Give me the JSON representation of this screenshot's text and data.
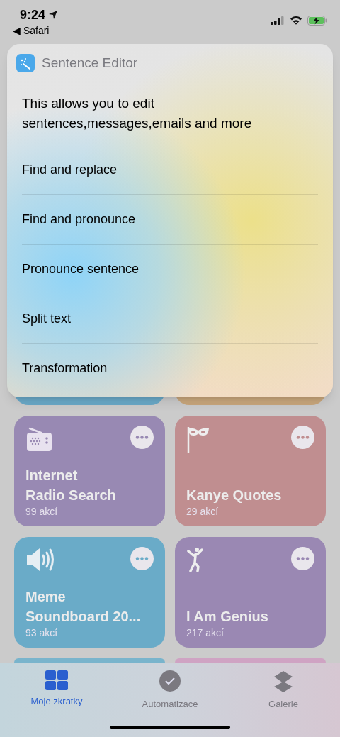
{
  "status_bar": {
    "time": "9:24",
    "back_link": "◀ Safari"
  },
  "shortcut_popup": {
    "app_name": "Sentence Editor",
    "description": "This allows you to edit sentences,messages,emails and more",
    "actions": [
      {
        "label": "Find and replace"
      },
      {
        "label": "Find and pronounce"
      },
      {
        "label": "Pronounce sentence"
      },
      {
        "label": "Split text"
      },
      {
        "label": "Transformation"
      }
    ]
  },
  "shortcuts": [
    {
      "kind": "partial",
      "color": "#6aa9c8"
    },
    {
      "kind": "partial",
      "color": "#c9a77c"
    },
    {
      "kind": "full",
      "title": "Internet\nRadio Search",
      "count": "99 akcí",
      "color": "#9889b3"
    },
    {
      "kind": "full",
      "title": "Kanye Quotes",
      "count": "29 akcí",
      "color": "#c08e90"
    },
    {
      "kind": "full",
      "title": "Meme\nSoundboard 20...",
      "count": "93 akcí",
      "color": "#6aabc8"
    },
    {
      "kind": "full",
      "title": "I Am Genius",
      "count": "217 akcí",
      "color": "#9a88b3"
    },
    {
      "kind": "peek",
      "color": "#79b4cc"
    },
    {
      "kind": "peek",
      "color": "#cfa3c3"
    }
  ],
  "tab_bar": [
    {
      "label": "Moje zkratky",
      "selected": true
    },
    {
      "label": "Automatizace",
      "selected": false
    },
    {
      "label": "Galerie",
      "selected": false
    }
  ]
}
